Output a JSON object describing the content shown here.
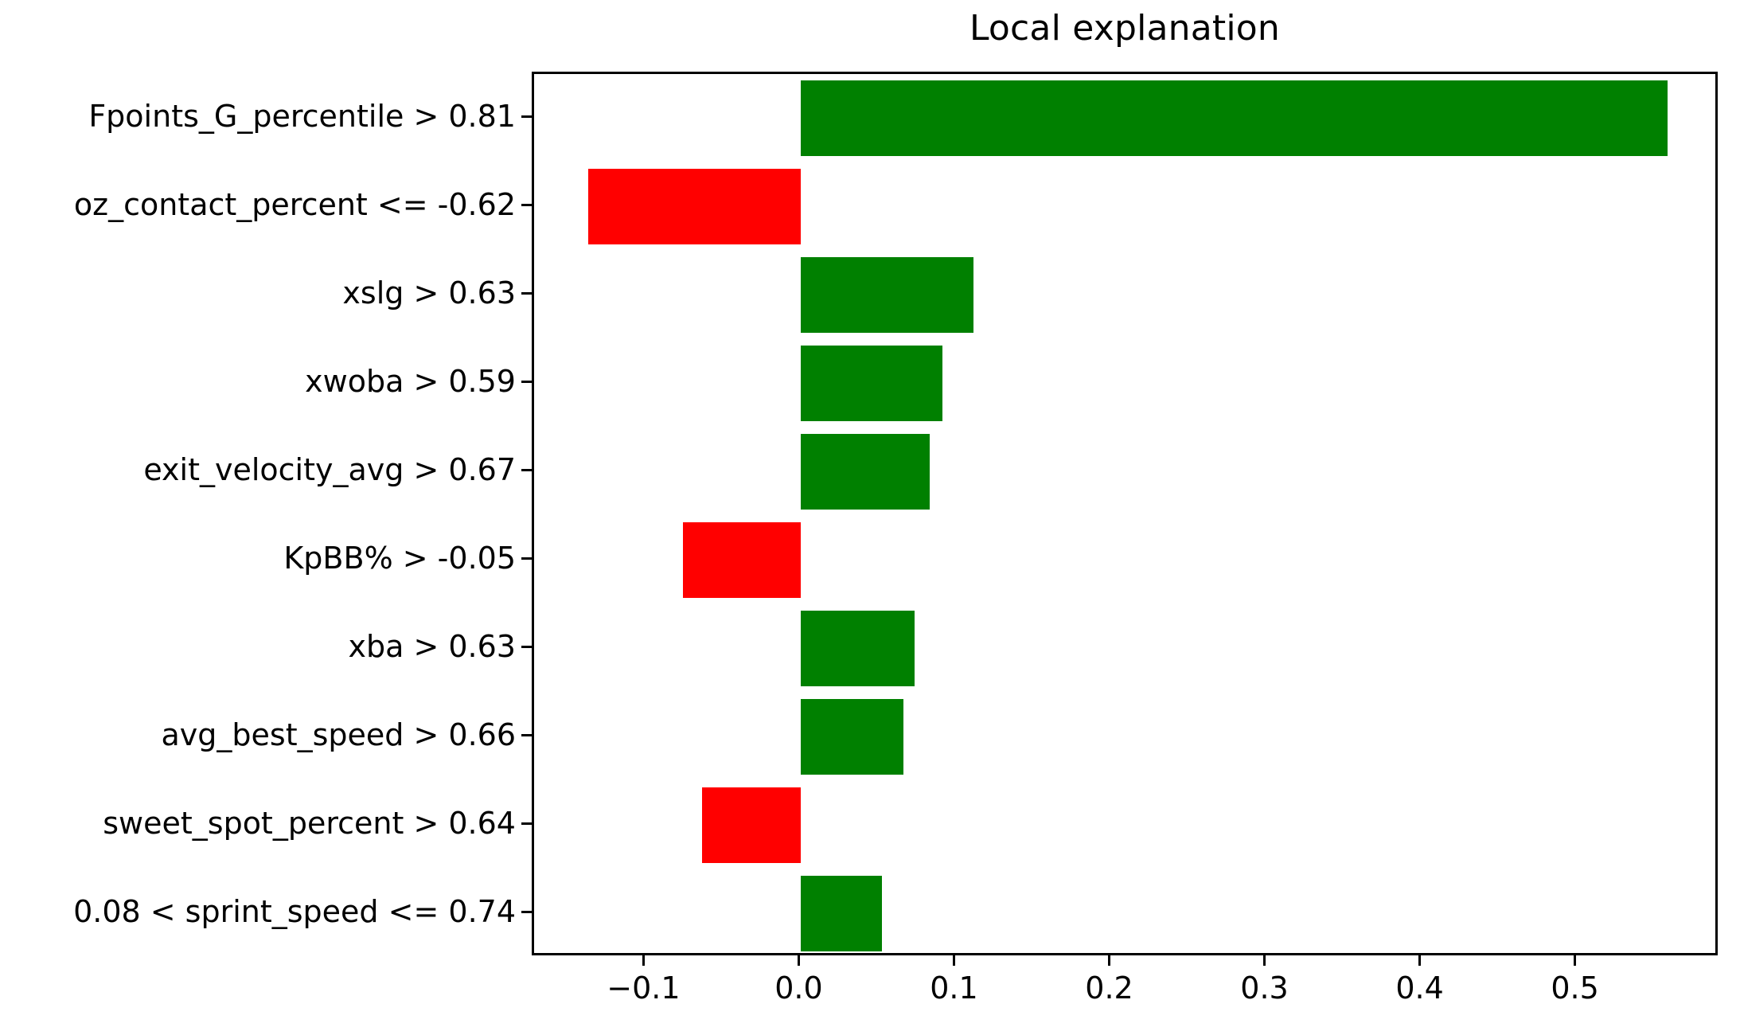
{
  "chart_data": {
    "type": "bar",
    "orientation": "horizontal",
    "title": "Local explanation",
    "xlabel": "",
    "ylabel": "",
    "grid": false,
    "legend": null,
    "xlim": [
      -0.172,
      0.592
    ],
    "xticks": [
      "−0.1",
      "0.0",
      "0.1",
      "0.2",
      "0.3",
      "0.4",
      "0.5"
    ],
    "xtick_values": [
      -0.1,
      0.0,
      0.1,
      0.2,
      0.3,
      0.4,
      0.5
    ],
    "categories": [
      "Fpoints_G_percentile > 0.81",
      "oz_contact_percent <= -0.62",
      "xslg > 0.63",
      "xwoba > 0.59",
      "exit_velocity_avg > 0.67",
      "KpBB% > -0.05",
      "xba > 0.63",
      "avg_best_speed > 0.66",
      "sweet_spot_percent > 0.64",
      "0.08 < sprint_speed <= 0.74"
    ],
    "values": [
      0.558,
      -0.137,
      0.111,
      0.091,
      0.083,
      -0.076,
      0.073,
      0.066,
      -0.064,
      0.052
    ],
    "colors": {
      "positive": "#008000",
      "negative": "#ff0000",
      "axis": "#000000",
      "background": "#ffffff"
    }
  }
}
